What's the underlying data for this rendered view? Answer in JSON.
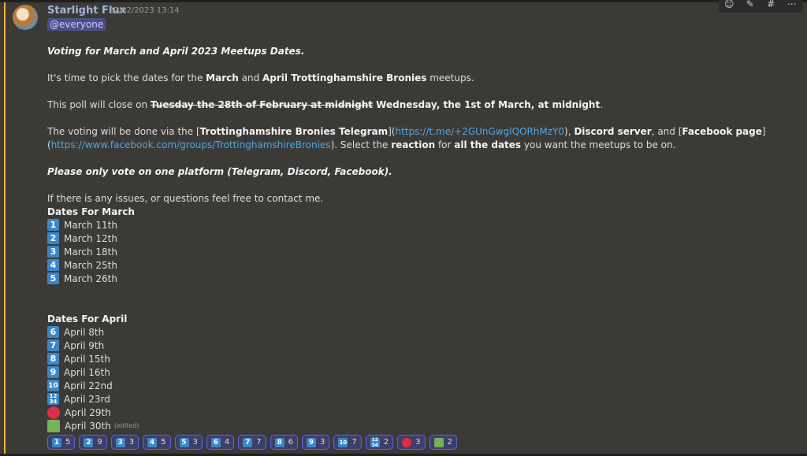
{
  "message": {
    "author": "Starlight Flux",
    "timestamp": "22/02/2023 13:14",
    "mention": "@everyone",
    "title": "Voting for March and April 2023 Meetups Dates.",
    "intro": {
      "pre": "It's time to pick the dates for the ",
      "b1": "March",
      "mid": " and ",
      "b2": "April Trottinghamshire Bronies",
      "post": " meetups."
    },
    "close": {
      "pre": "This poll will close on ",
      "struck": "Tuesday the 28th of February at midnight",
      "new": " Wednesday, the 1st of March, at midnight",
      "post": "."
    },
    "voting": {
      "pre": "The voting will be done via the [",
      "telegram": "Trottinghamshire Bronies Telegram",
      "mid1": "](",
      "telegram_link": "https://t.me/+2GUnGwglQORhMzY0",
      "mid2": "), ",
      "discord": "Discord server",
      "mid3": ", and [",
      "facebook": "Facebook page",
      "mid4": "]",
      "line2_pre": "(",
      "facebook_link": "https://www.facebook.com/groups/TrottinghamshireBronies",
      "line2_mid": ").   Select the ",
      "reaction": "reaction",
      "line2_mid2": " for ",
      "all_dates": "all the dates",
      "line2_post": " you want the meetups to be on."
    },
    "platform_note": "Please only vote on one platform (Telegram, Discord, Facebook).",
    "contact": "If there is any issues, or questions feel free to contact me.",
    "march_heading": "Dates For March",
    "march_dates": [
      {
        "emoji": "1",
        "label": "March 11th"
      },
      {
        "emoji": "2",
        "label": "March 12th"
      },
      {
        "emoji": "3",
        "label": "March 18th"
      },
      {
        "emoji": "4",
        "label": "March 25th"
      },
      {
        "emoji": "5",
        "label": "March 26th"
      }
    ],
    "april_heading": "Dates For April",
    "april_dates": [
      {
        "emoji": "6",
        "label": "April 8th"
      },
      {
        "emoji": "7",
        "label": "April 9th"
      },
      {
        "emoji": "8",
        "label": "April 15th"
      },
      {
        "emoji": "9",
        "label": "April 16th"
      },
      {
        "emoji": "10",
        "label": "April 22nd"
      },
      {
        "emoji": "1234",
        "label": "April 23rd"
      },
      {
        "emoji": "red-circle",
        "label": "April 29th"
      },
      {
        "emoji": "green-square",
        "label": "April 30th"
      }
    ],
    "edited": "(edited)"
  },
  "reactions": [
    {
      "emoji": "1",
      "count": "5"
    },
    {
      "emoji": "2",
      "count": "9"
    },
    {
      "emoji": "3",
      "count": "3"
    },
    {
      "emoji": "4",
      "count": "5"
    },
    {
      "emoji": "5",
      "count": "3"
    },
    {
      "emoji": "6",
      "count": "4"
    },
    {
      "emoji": "7",
      "count": "7"
    },
    {
      "emoji": "8",
      "count": "6"
    },
    {
      "emoji": "9",
      "count": "3"
    },
    {
      "emoji": "10",
      "count": "7"
    },
    {
      "emoji": "1234",
      "count": "2"
    },
    {
      "emoji": "red-circle",
      "count": "3"
    },
    {
      "emoji": "green-square",
      "count": "2"
    }
  ],
  "toolbar": {
    "icons": [
      "add-reaction-icon",
      "edit-icon",
      "thread-icon",
      "more-icon"
    ]
  },
  "colors": {
    "accent": "#f0b232",
    "keycap": "#3d86c6",
    "link": "#4fa6e6",
    "mention_bg": "#4d4f8a"
  }
}
